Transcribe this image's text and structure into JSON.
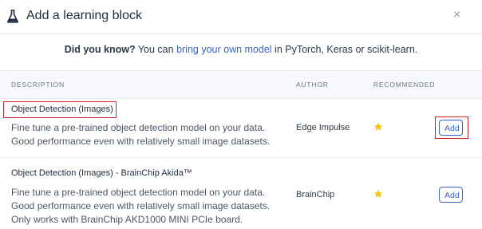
{
  "dialog": {
    "title": "Add a learning block",
    "close_icon": "×",
    "icon": "flask-icon"
  },
  "tip": {
    "lead": "Did you know?",
    "pre": " You can ",
    "link": "bring your own model",
    "post": " in PyTorch, Keras or scikit-learn."
  },
  "table": {
    "headers": [
      "DESCRIPTION",
      "AUTHOR",
      "RECOMMENDED"
    ],
    "rows": [
      {
        "title": "Object Detection (Images)",
        "description": "Fine tune a pre-trained object detection model on your data. Good performance even with relatively small image datasets.",
        "author": "Edge Impulse",
        "recommended": true,
        "button": "Add"
      },
      {
        "title": "Object Detection (Images) - BrainChip Akida™",
        "description": "Fine tune a pre-trained object detection model on your data. Good performance even with relatively small image datasets. Only works with BrainChip AKD1000 MINI PCIe board.",
        "author": "BrainChip",
        "recommended": true,
        "button": "Add"
      }
    ]
  },
  "colors": {
    "accent": "#3a64c9",
    "highlight": "#d0202a",
    "star": "#f5c518"
  }
}
